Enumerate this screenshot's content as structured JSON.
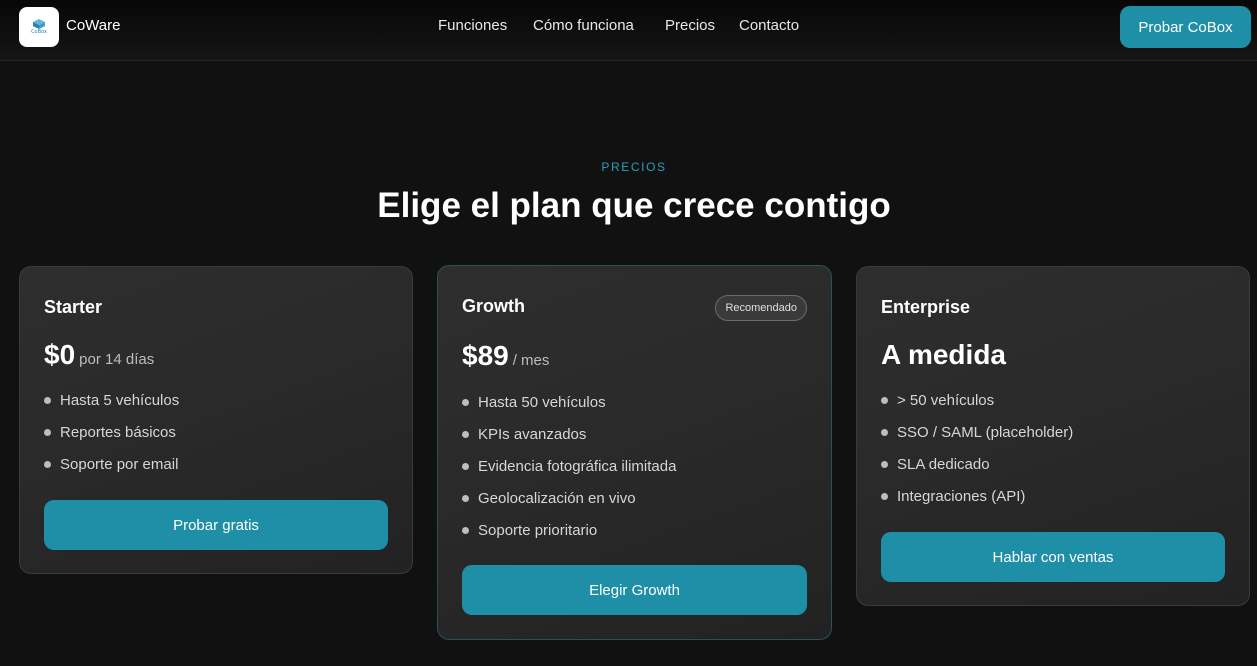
{
  "header": {
    "brand": "CoWare",
    "logo_text": "CoBox",
    "nav": [
      "Funciones",
      "Cómo funciona",
      "Precios",
      "Contacto"
    ],
    "cta": "Probar CoBox"
  },
  "pricing": {
    "eyebrow": "PRECIOS",
    "title": "Elige el plan que crece contigo",
    "plans": [
      {
        "name": "Starter",
        "price": "$0",
        "price_note": "por 14 días",
        "features": [
          "Hasta 5 vehículos",
          "Reportes básicos",
          "Soporte por email"
        ],
        "button": "Probar gratis"
      },
      {
        "name": "Growth",
        "badge": "Recomendado",
        "price": "$89",
        "price_note": "/ mes",
        "features": [
          "Hasta 50 vehículos",
          "KPIs avanzados",
          "Evidencia fotográfica ilimitada",
          "Geolocalización en vivo",
          "Soporte prioritario"
        ],
        "button": "Elegir Growth"
      },
      {
        "name": "Enterprise",
        "price": "A medida",
        "features": [
          "> 50 vehículos",
          "SSO / SAML (placeholder)",
          "SLA dedicado",
          "Integraciones (API)"
        ],
        "button": "Hablar con ventas"
      }
    ]
  },
  "colors": {
    "accent": "#1f8fa8",
    "background": "#111111",
    "eyebrow": "#2aa0b8"
  }
}
